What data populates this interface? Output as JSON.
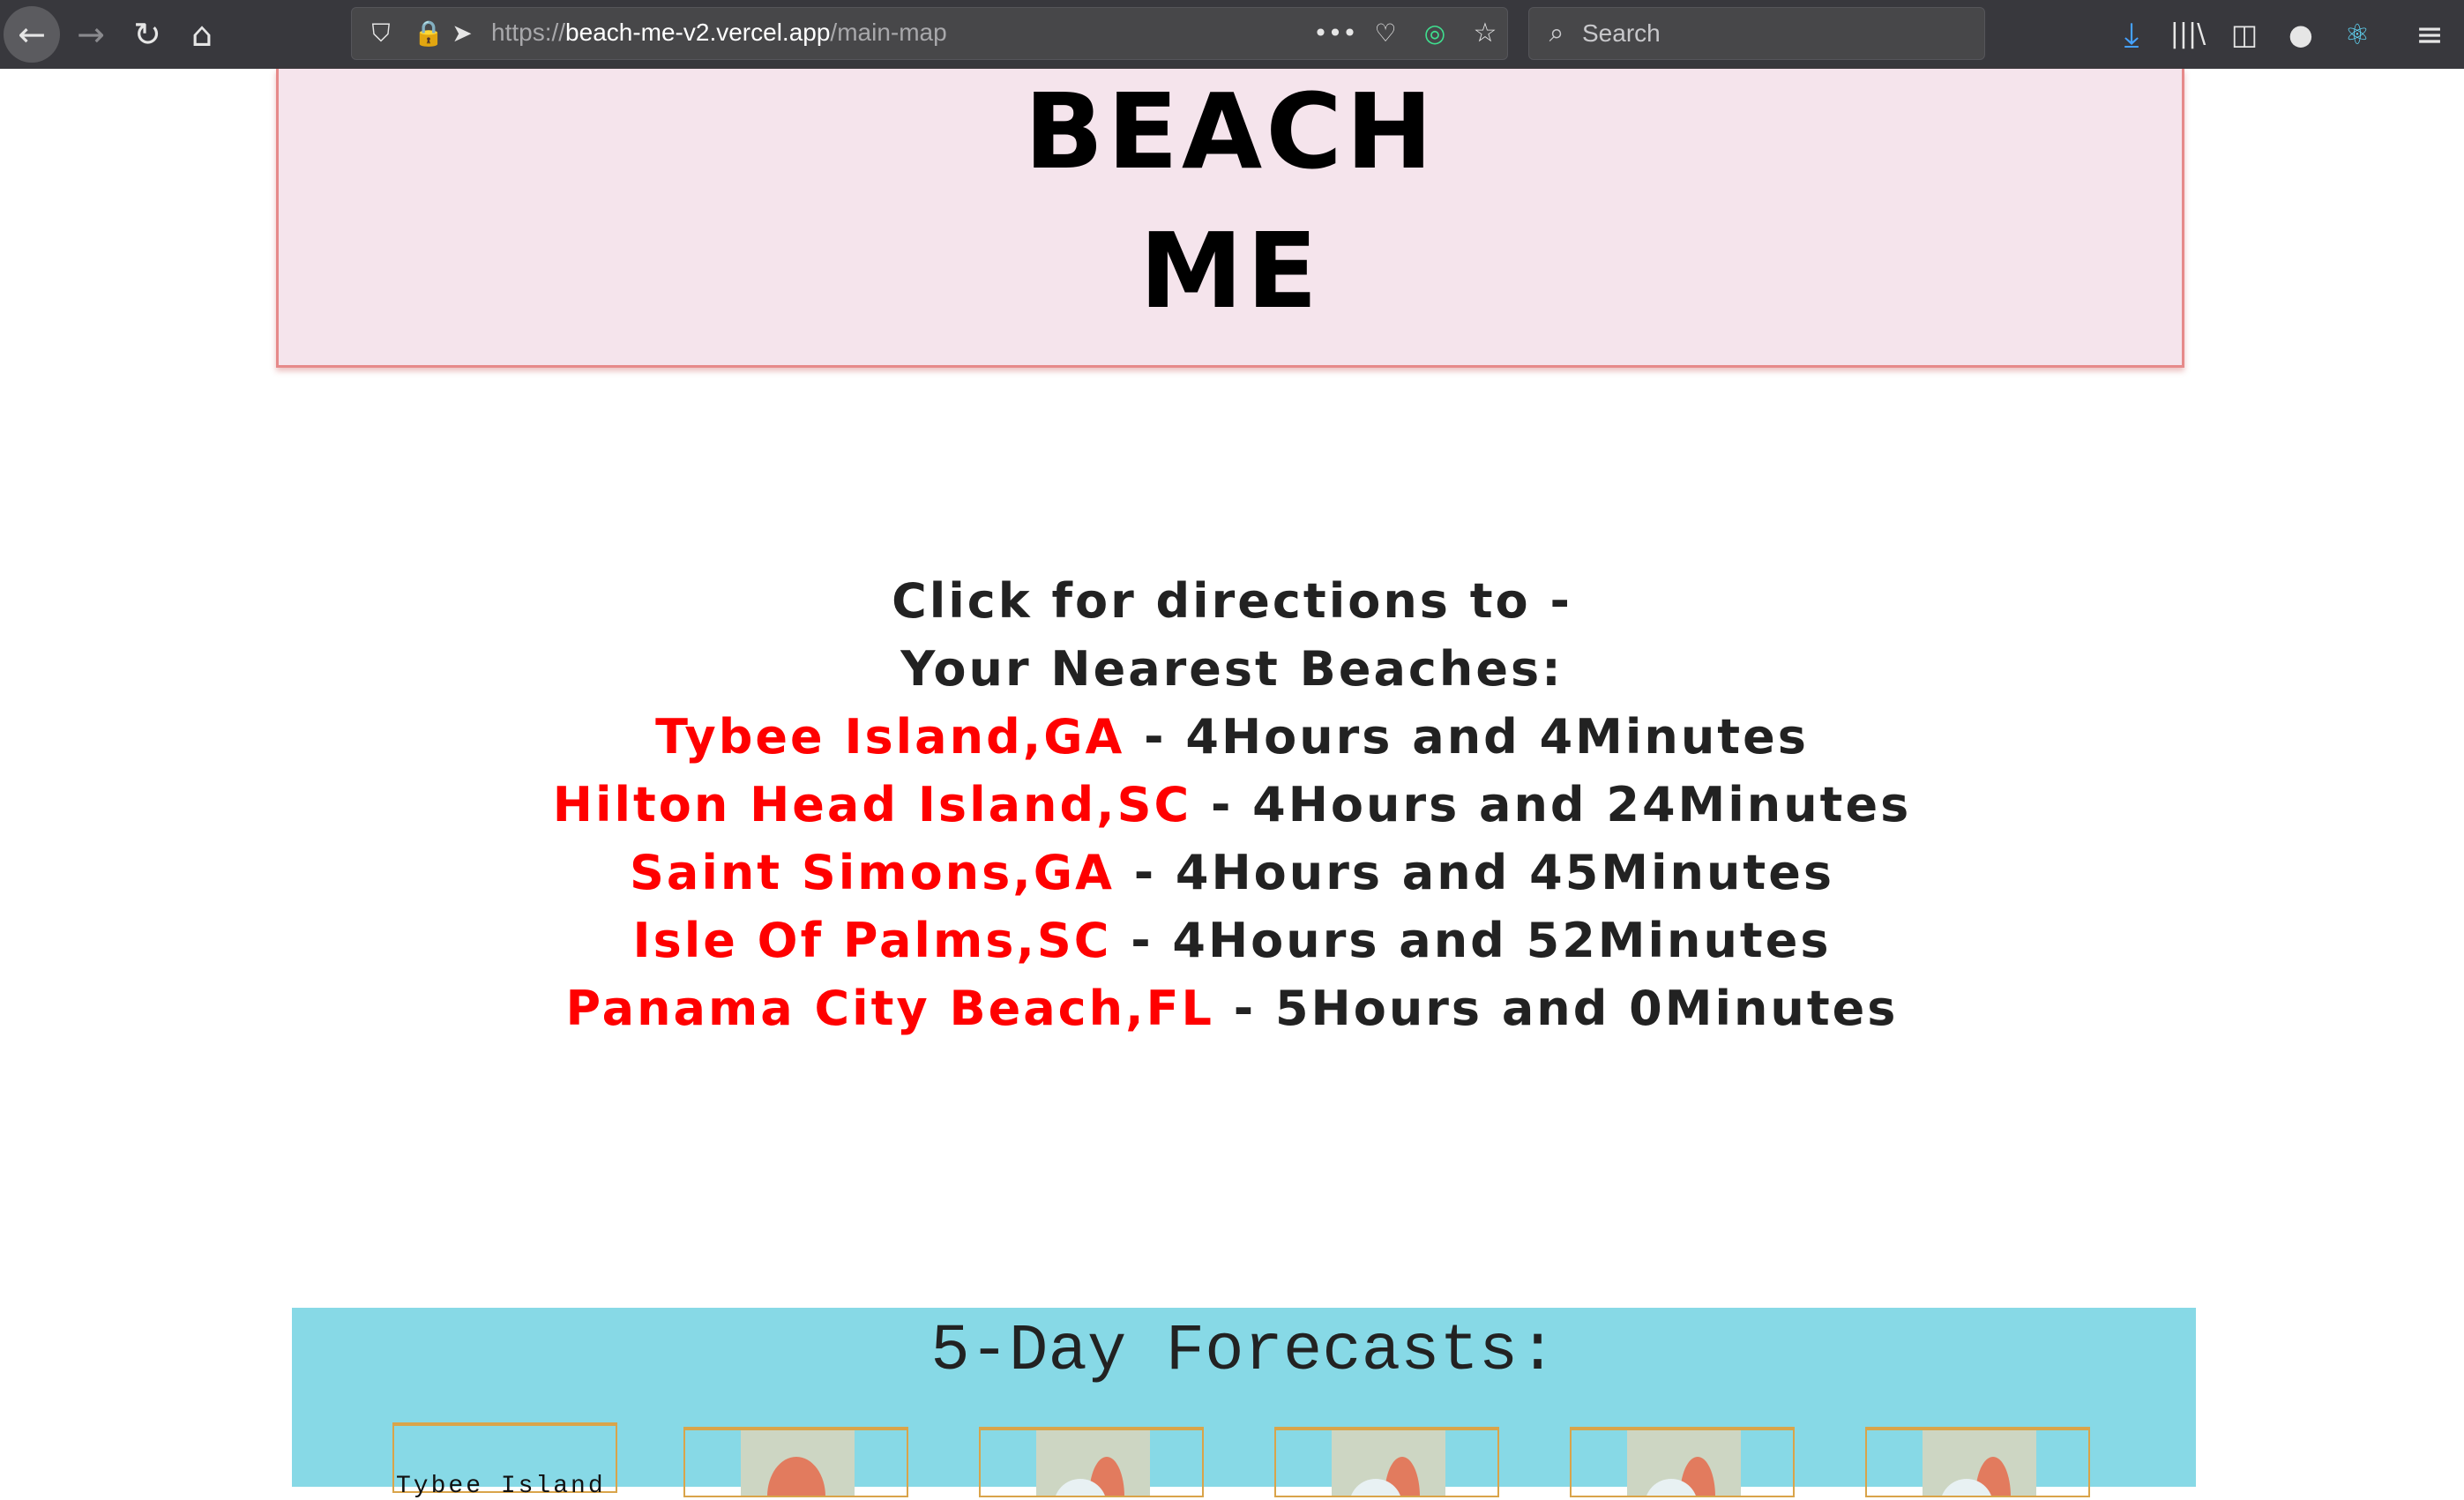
{
  "browser": {
    "url_scheme": "https://",
    "url_domain": "beach-me-v2.vercel.app",
    "url_path": "/main-map",
    "search_placeholder": "Search"
  },
  "header": {
    "logo_line1": "BEACH",
    "logo_line2": "ME"
  },
  "directions": {
    "line1": "Click for directions to -",
    "line2": "Your Nearest Beaches:",
    "beaches": [
      {
        "name": "Tybee Island,GA",
        "time": " - 4Hours and 4Minutes"
      },
      {
        "name": "Hilton Head Island,SC",
        "time": " - 4Hours and 24Minutes"
      },
      {
        "name": "Saint Simons,GA",
        "time": " - 4Hours and 45Minutes"
      },
      {
        "name": "Isle Of Palms,SC",
        "time": " - 4Hours and 52Minutes"
      },
      {
        "name": "Panama City Beach,FL",
        "time": " - 5Hours and 0Minutes"
      }
    ]
  },
  "forecast": {
    "title": "5-Day Forecasts:",
    "location": "Tybee Island",
    "day_icons": [
      "sunny",
      "partly-cloudy",
      "partly-cloudy",
      "partly-cloudy",
      "partly-cloudy"
    ]
  },
  "colors": {
    "link": "#ff0000",
    "forecast_bg": "#87d9e6",
    "header_bg": "#f5e4ec"
  }
}
